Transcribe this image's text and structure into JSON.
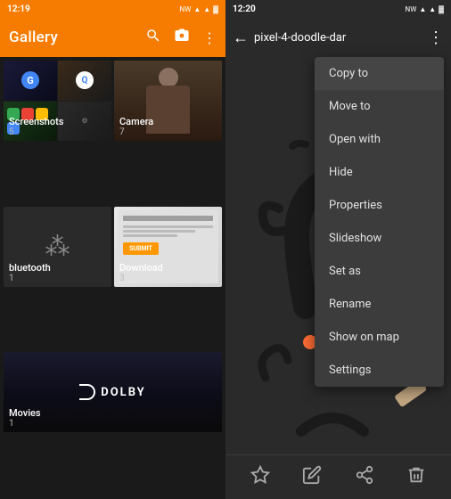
{
  "left": {
    "statusBar": {
      "time": "12:19",
      "icons": [
        "NW",
        "▼",
        "▲",
        "📶",
        "🔋"
      ]
    },
    "header": {
      "title": "Gallery",
      "searchIcon": "🔍",
      "cameraIcon": "📷",
      "moreIcon": "⋮"
    },
    "folders": [
      {
        "name": "Screenshots",
        "count": "5"
      },
      {
        "name": "Camera",
        "count": "7"
      },
      {
        "name": "bluetooth",
        "count": "1"
      },
      {
        "name": "Download",
        "count": "3"
      },
      {
        "name": "Movies",
        "count": "1"
      }
    ]
  },
  "right": {
    "statusBar": {
      "time": "12:20",
      "icons": [
        "NW",
        "▼",
        "▲",
        "📶",
        "🔋"
      ]
    },
    "header": {
      "backIcon": "←",
      "title": "pixel-4-doodle-dar",
      "moreIcon": "⋮"
    },
    "contextMenu": {
      "items": [
        "Copy to",
        "Move to",
        "Open with",
        "Hide",
        "Properties",
        "Slideshow",
        "Set as",
        "Rename",
        "Show on map",
        "Settings"
      ]
    },
    "toolbar": {
      "starIcon": "☆",
      "editIcon": "✏",
      "shareIcon": "↗",
      "deleteIcon": "🗑"
    }
  }
}
